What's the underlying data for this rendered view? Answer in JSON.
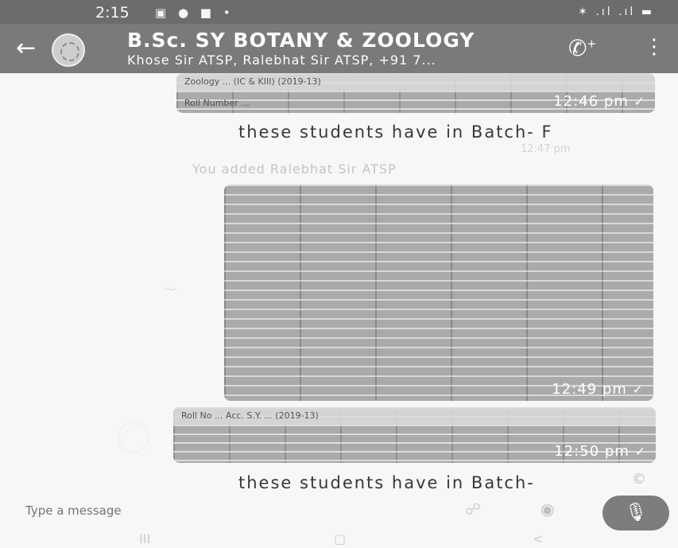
{
  "status_bar": {
    "time": "2:15",
    "icons": "▣ ● ■ •",
    "right_icons": "✶ .ıl .ıl ▬"
  },
  "app_bar": {
    "title": "B.Sc. SY BOTANY & ZOOLOGY",
    "subtitle": "Khose Sir ATSP, Ralebhat Sir ATSP, +91 7..."
  },
  "messages": [
    {
      "type": "image",
      "time": "12:46 pm",
      "header_text": "Zoology ... (IC & KIII) (2019-13)",
      "row_text": "Roll Number ..."
    },
    {
      "type": "text",
      "text": "these students  have in Batch- F",
      "time": "12:47 pm"
    },
    {
      "type": "system",
      "text": "You added Ralebhat Sir ATSP"
    },
    {
      "type": "image",
      "time": "12:49 pm"
    },
    {
      "type": "image",
      "time": "12:50 pm",
      "header_text": "Roll No ...  Acc. S.Y. ... (2019-13)"
    },
    {
      "type": "text",
      "text": "these students  have in Batch-",
      "extra": "©"
    }
  ],
  "input": {
    "placeholder": "Type a message"
  },
  "nav": {
    "recent": "III",
    "home": "▢",
    "back": "<"
  }
}
